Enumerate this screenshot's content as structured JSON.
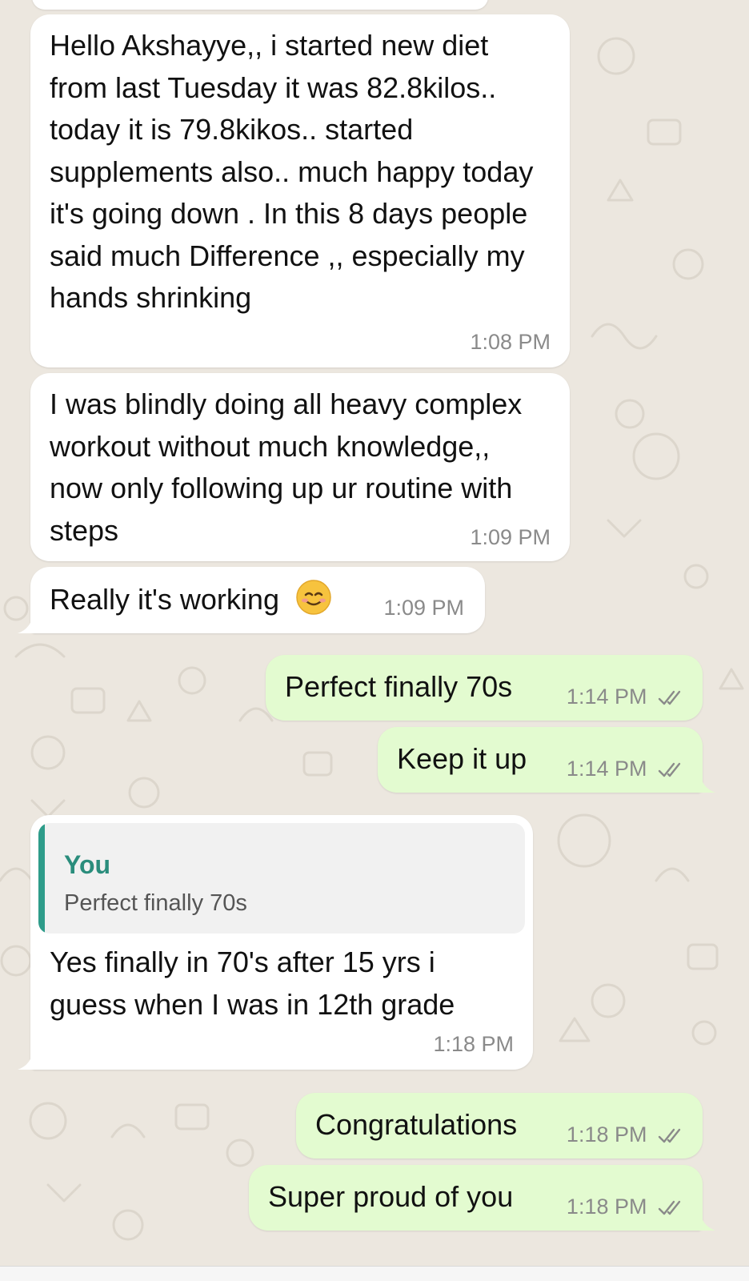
{
  "colors": {
    "background": "#ece7df",
    "incoming_bubble": "#ffffff",
    "outgoing_bubble": "#e3fbd0",
    "quote_accent": "#2e9c8a",
    "timestamp": "#8a8a8a",
    "read_ticks": "#8a8a8a"
  },
  "messages": [
    {
      "direction": "incoming",
      "text": "Hello Akshayye,, i started new diet from last Tuesday it was 82.8kilos.. today it is 79.8kikos.. started supplements also.. much happy today it's going down . In this 8 days people said much Difference ,, especially my hands shrinking",
      "time": "1:08 PM"
    },
    {
      "direction": "incoming",
      "text": "I was blindly doing all heavy complex workout without much knowledge,, now only following up ur routine with steps",
      "time": "1:09 PM"
    },
    {
      "direction": "incoming",
      "text": "Really it's working",
      "emoji": "smiling-face-icon",
      "time": "1:09 PM"
    },
    {
      "direction": "outgoing",
      "text": "Perfect finally 70s",
      "time": "1:14 PM",
      "status": "read-ticks-icon"
    },
    {
      "direction": "outgoing",
      "text": "Keep it up",
      "time": "1:14 PM",
      "status": "read-ticks-icon"
    },
    {
      "direction": "incoming",
      "quote": {
        "author": "You",
        "text": "Perfect finally 70s"
      },
      "text": "Yes finally in 70's after 15 yrs i guess when I was in 12th grade",
      "time": "1:18 PM"
    },
    {
      "direction": "outgoing",
      "text": "Congratulations",
      "time": "1:18 PM",
      "status": "read-ticks-icon"
    },
    {
      "direction": "outgoing",
      "text": "Super proud of you",
      "time": "1:18 PM",
      "status": "read-ticks-icon"
    }
  ]
}
